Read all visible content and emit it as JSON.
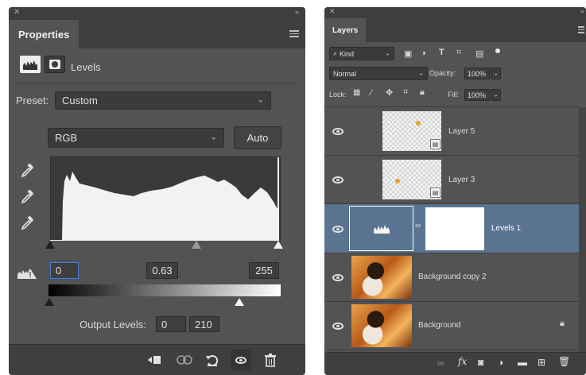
{
  "properties": {
    "tab_label": "Properties",
    "adjustment_label": "Levels",
    "preset_label": "Preset:",
    "preset_value": "Custom",
    "channel_value": "RGB",
    "auto_label": "Auto",
    "input_black": "0",
    "input_gamma": "0.63",
    "input_white": "255",
    "output_label": "Output Levels:",
    "output_black": "0",
    "output_white": "210"
  },
  "layers": {
    "tab_label": "Layers",
    "filter_kind": "Kind",
    "blend_mode": "Normal",
    "opacity_label": "Opacity:",
    "opacity_value": "100%",
    "lock_label": "Lock:",
    "fill_label": "Fill:",
    "fill_value": "100%",
    "items": [
      {
        "name": "Layer 5"
      },
      {
        "name": "Layer 3"
      },
      {
        "name": "Levels 1"
      },
      {
        "name": "Background copy 2"
      },
      {
        "name": "Background"
      }
    ]
  },
  "icons": {
    "close": "close-icon",
    "collapse": "collapse-icon",
    "menu": "panel-menu-icon"
  },
  "colors": {
    "panel_bg": "#535353",
    "selected_row": "#5a7390"
  }
}
